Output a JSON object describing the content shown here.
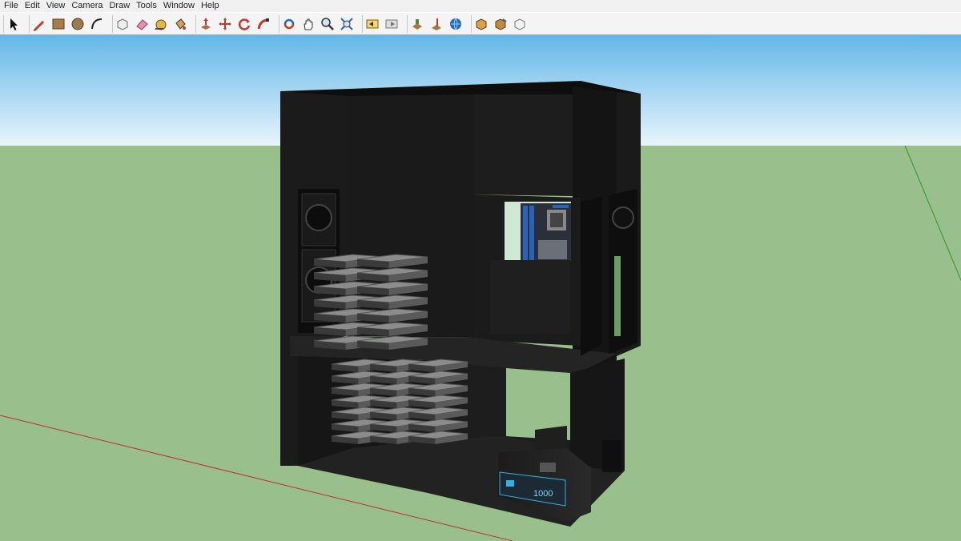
{
  "menu": [
    "File",
    "Edit",
    "View",
    "Camera",
    "Draw",
    "Tools",
    "Window",
    "Help"
  ],
  "toolbar": {
    "groups": [
      [
        "select-tool"
      ],
      [
        "pencil-line-tool",
        "rectangle-tool",
        "circle-tool",
        "arc-tool"
      ],
      [
        "make-component-tool",
        "eraser-tool",
        "tape-measure-tool",
        "paint-bucket-tool"
      ],
      [
        "push-pull-tool",
        "move-tool",
        "rotate-tool",
        "follow-me-tool"
      ],
      [
        "orbit-tool",
        "pan-tool",
        "zoom-tool",
        "zoom-extents-tool"
      ],
      [
        "previous-view-tool",
        "next-view-tool"
      ],
      [
        "add-location-tool",
        "toggle-terrain-tool",
        "photo-textures-tool"
      ],
      [
        "get-models-tool",
        "share-model-tool",
        "share-component-tool"
      ]
    ]
  },
  "psu_label": "1000",
  "colors": {
    "sky_top": "#63b7e8",
    "sky_bottom": "#e6f3fb",
    "ground": "#98bf8c",
    "case_dark": "#161616",
    "case_mid": "#222222",
    "accent_blue": "#2fb3e0"
  }
}
